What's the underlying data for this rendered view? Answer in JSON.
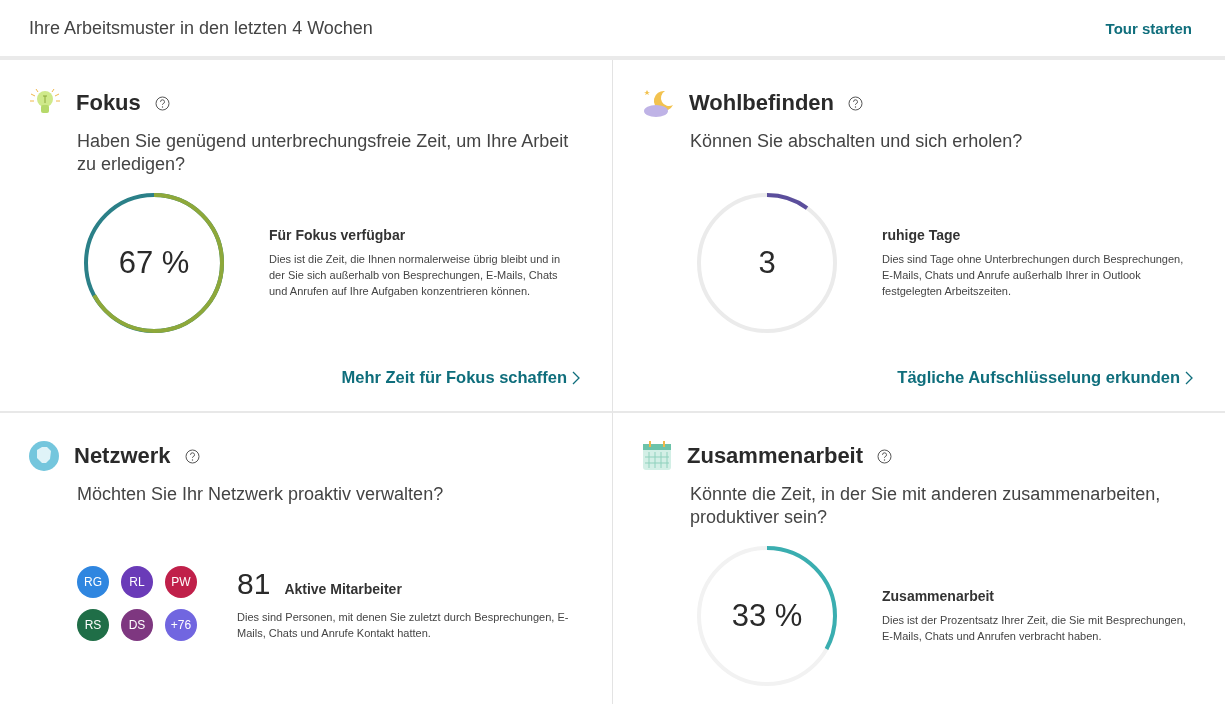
{
  "header": {
    "title": "Ihre Arbeitsmuster in den letzten 4 Wochen",
    "tour_link": "Tour starten"
  },
  "cards": [
    {
      "kind": "ring",
      "title": "Fokus",
      "question": "Haben Sie genügend unterbrechungsfreie Zeit, um Ihre Arbeit zu erledigen?",
      "ring_text": "67 %",
      "level": 0.67,
      "color": "#8ea83a",
      "caption": "Für Fokus verfügbar",
      "description": "Dies ist die Zeit, die Ihnen normalerweise übrig bleibt und in der Sie sich außerhalb von Besprechungen, E-Mails, Chats und Anrufen auf Ihre Aufgaben konzentrieren können.",
      "link": "Mehr Zeit für Fokus schaffen"
    },
    {
      "kind": "ring",
      "title": "Wohlbefinden",
      "question": "Können Sie abschalten und sich erholen?",
      "ring_text": "3",
      "level": 0.1,
      "color": "#5b4e9c",
      "caption": "ruhige Tage",
      "description": "Dies sind Tage ohne Unterbrechungen durch Besprechungen, E-Mails, Chats und Anrufe außerhalb Ihrer in Outlook festgelegten Arbeitszeiten.",
      "link": "Tägliche Aufschlüsselung erkunden"
    },
    {
      "kind": "network",
      "title": "Netzwerk",
      "question": "Möchten Sie Ihr Netzwerk proaktiv verwalten?",
      "avatars": [
        {
          "initials": "RG",
          "color": "#2f86e0"
        },
        {
          "initials": "RL",
          "color": "#6a3bb8"
        },
        {
          "initials": "PW",
          "color": "#c0204a"
        },
        {
          "initials": "RS",
          "color": "#1f6e47"
        },
        {
          "initials": "DS",
          "color": "#7e3780"
        },
        {
          "initials": "+76",
          "color": "#7166e0"
        }
      ],
      "count": "81",
      "count_caption": "Aktive Mitarbeiter",
      "description": "Dies sind Personen, mit denen Sie zuletzt durch Besprechungen, E-Mails, Chats und Anrufe Kontakt hatten."
    },
    {
      "kind": "ring",
      "title": "Zusammenarbeit",
      "question": "Könnte die Zeit, in der Sie mit anderen zusammenarbeiten, produktiver sein?",
      "ring_text": "33 %",
      "level": 0.33,
      "color": "#3aaeb0",
      "caption": "Zusammenarbeit",
      "description": "Dies ist der Prozentsatz Ihrer Zeit, die Sie mit Besprechungen, E-Mails, Chats und Anrufen verbracht haben."
    }
  ]
}
